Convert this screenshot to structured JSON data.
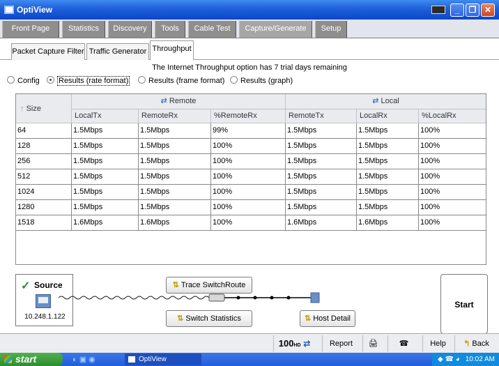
{
  "window": {
    "title": "OptiView",
    "icons": [
      "keyboard-icon",
      "minimize-icon",
      "maximize-icon",
      "close-icon"
    ]
  },
  "main_tabs": [
    "Front Page",
    "Statistics",
    "Discovery",
    "Tools",
    "Cable Test",
    "Capture/Generate",
    "Setup"
  ],
  "active_main_tab": "Capture/Generate",
  "sub_tabs": [
    "Packet Capture Filter",
    "Traffic Generator",
    "Throughput"
  ],
  "active_sub_tab": "Throughput",
  "trial_notice": "The Internet Throughput option has 7 trial days remaining",
  "view_options": {
    "config": "Config",
    "results_rate": "Results (rate format)",
    "results_frame": "Results (frame format)",
    "results_graph": "Results (graph)",
    "selected": "Results (rate format)"
  },
  "table": {
    "size_header": "Size",
    "remote_group": "Remote",
    "local_group": "Local",
    "columns": [
      "LocalTx",
      "RemoteRx",
      "%RemoteRx",
      "RemoteTx",
      "LocalRx",
      "%LocalRx"
    ],
    "rows": [
      [
        "64",
        "1.5Mbps",
        "1.5Mbps",
        "99%",
        "1.5Mbps",
        "1.5Mbps",
        "100%"
      ],
      [
        "128",
        "1.5Mbps",
        "1.5Mbps",
        "100%",
        "1.5Mbps",
        "1.5Mbps",
        "100%"
      ],
      [
        "256",
        "1.5Mbps",
        "1.5Mbps",
        "100%",
        "1.5Mbps",
        "1.5Mbps",
        "100%"
      ],
      [
        "512",
        "1.5Mbps",
        "1.5Mbps",
        "100%",
        "1.5Mbps",
        "1.5Mbps",
        "100%"
      ],
      [
        "1024",
        "1.5Mbps",
        "1.5Mbps",
        "100%",
        "1.5Mbps",
        "1.5Mbps",
        "100%"
      ],
      [
        "1280",
        "1.5Mbps",
        "1.5Mbps",
        "100%",
        "1.5Mbps",
        "1.5Mbps",
        "100%"
      ],
      [
        "1518",
        "1.6Mbps",
        "1.6Mbps",
        "100%",
        "1.6Mbps",
        "1.6Mbps",
        "100%"
      ]
    ]
  },
  "source": {
    "label": "Source",
    "ip": "10.248.1.122"
  },
  "buttons": {
    "trace": "Trace SwitchRoute",
    "switch_stats": "Switch Statistics",
    "host_detail": "Host Detail",
    "start": "Start"
  },
  "bottom_bar": {
    "speed": "100",
    "speed_unit": "HD",
    "report": "Report",
    "help": "Help",
    "back": "Back"
  },
  "taskbar": {
    "start": "start",
    "task": "OptiView",
    "clock": "10:02 AM"
  },
  "colors": {
    "title_bar": "#1f5fd9",
    "tab_bg": "#8e8e8e",
    "accent_green": "#2e8c2e"
  }
}
